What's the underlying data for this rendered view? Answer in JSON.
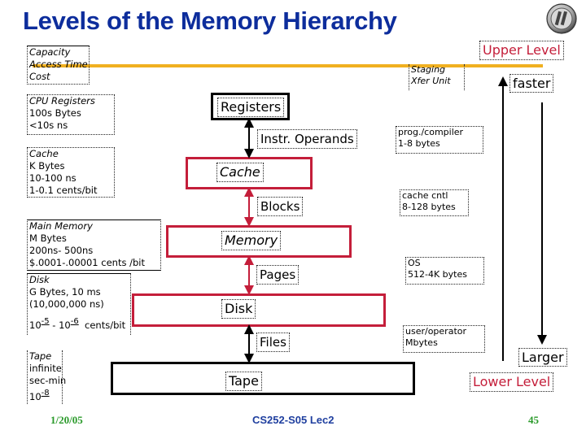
{
  "slide": {
    "title": "Levels of the Memory Hierarchy",
    "logo_icon": "university-seal-icon"
  },
  "legend_header": {
    "lines": [
      "Capacity",
      "Access Time",
      "Cost"
    ]
  },
  "staging_header": {
    "lines": [
      "Staging",
      "Xfer Unit"
    ]
  },
  "levels": [
    {
      "name": "Registers",
      "lines": [
        "CPU Registers",
        "100s Bytes",
        "<10s ns"
      ]
    },
    {
      "name": "Cache",
      "lines": [
        "Cache",
        "K Bytes",
        "10-100 ns",
        "1-0.1 cents/bit"
      ]
    },
    {
      "name": "Memory",
      "lines": [
        "Main Memory",
        "M Bytes",
        "200ns- 500ns",
        "$.0001-.00001 cents /bit"
      ]
    },
    {
      "name": "Disk",
      "lines": [
        "Disk",
        "G Bytes, 10 ms",
        "(10,000,000 ns)"
      ],
      "cost": {
        "base1": "10",
        "exp1": "-5",
        "sep": " - ",
        "base2": "10",
        "exp2": "-6",
        "unit": "cents/bit"
      }
    },
    {
      "name": "Tape",
      "lines": [
        "Tape",
        "infinite",
        "sec-min"
      ],
      "cost": {
        "base": "10",
        "exp": "-8"
      }
    }
  ],
  "transfers": [
    {
      "unit": "Instr. Operands",
      "managed_by": "prog./compiler",
      "size": "1-8 bytes"
    },
    {
      "unit": "Blocks",
      "managed_by": "cache cntl",
      "size": "8-128 bytes"
    },
    {
      "unit": "Pages",
      "managed_by": "OS",
      "size": "512-4K bytes"
    },
    {
      "unit": "Files",
      "managed_by": "user/operator",
      "size": "Mbytes"
    }
  ],
  "direction": {
    "upper_level": "Upper Level",
    "lower_level": "Lower Level",
    "faster": "faster",
    "larger": "Larger"
  },
  "colors": {
    "title": "#0d2d9c",
    "level_red": "#c41e3a",
    "level_black": "#000000",
    "timeline_gold": "#f0b020",
    "footer_green": "#2a9a2a",
    "footer_blue": "#1f3f9f"
  },
  "footer": {
    "date": "1/20/05",
    "course": "CS252-S05 Lec2",
    "page": "45"
  }
}
